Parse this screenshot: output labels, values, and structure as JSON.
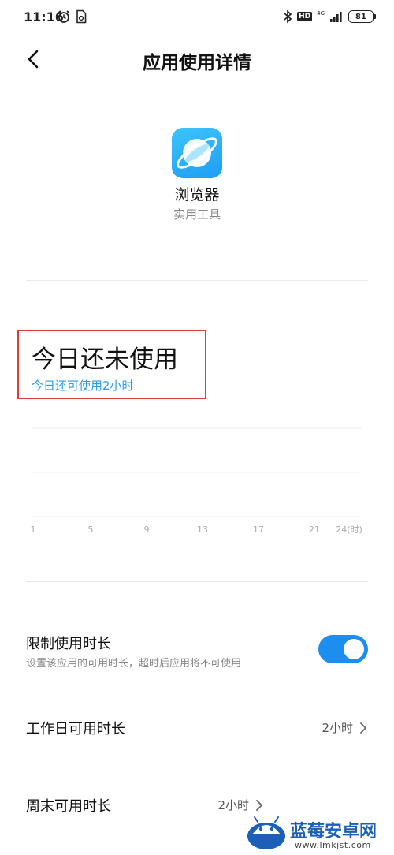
{
  "status_bar": {
    "time": "11:16",
    "hd": "HD",
    "network": "4G",
    "battery": "81"
  },
  "header": {
    "title": "应用使用详情"
  },
  "app": {
    "name": "浏览器",
    "category": "实用工具",
    "icon": "planet-icon"
  },
  "usage": {
    "main_text": "今日还未使用",
    "sub_text": "今日还可使用2小时"
  },
  "chart_data": {
    "type": "bar",
    "x_ticks": [
      "1",
      "5",
      "9",
      "13",
      "17",
      "21",
      "24(时)"
    ],
    "values": [],
    "grid": true
  },
  "settings": {
    "limit": {
      "label": "限制使用时长",
      "description": "设置该应用的可用时长，超时后应用将不可使用",
      "enabled": true
    },
    "workday": {
      "label": "工作日可用时长",
      "value": "2小时"
    },
    "weekend": {
      "label": "周末可用时长",
      "value": "2小时"
    }
  },
  "watermark": {
    "name": "蓝莓安卓网",
    "url": "www.lmkjst.com"
  },
  "colors": {
    "accent": "#2a9df0",
    "toggle": "#1b8ef0",
    "highlight_border": "#e13b3b"
  }
}
